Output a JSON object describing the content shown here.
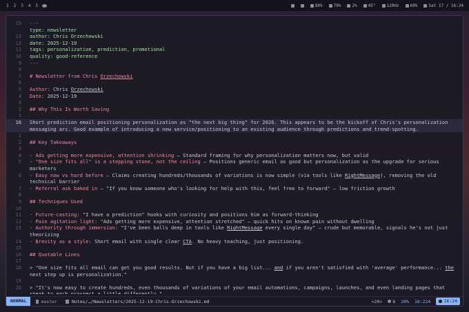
{
  "topbar": {
    "workspaces": [
      "1",
      "2",
      "3",
      "4",
      "5"
    ],
    "active_workspace": "3",
    "status": [
      {
        "icon": "keyboard-icon",
        "text": ""
      },
      {
        "icon": "refresh-icon",
        "text": ""
      },
      {
        "icon": "heart-icon",
        "text": "80%"
      },
      {
        "icon": "volume-icon",
        "text": "79%"
      },
      {
        "icon": "cpu-icon",
        "text": "2%"
      },
      {
        "icon": "temperature-icon",
        "text": "45°"
      },
      {
        "icon": "refresh-rate-icon",
        "text": "120Hz"
      },
      {
        "icon": "battery-icon",
        "text": "60%"
      },
      {
        "icon": "clock-icon",
        "text": "Sat 17 / 16:24"
      }
    ]
  },
  "editor": {
    "lines": [
      {
        "n": "15",
        "segs": [
          {
            "t": "---",
            "c": "fm"
          }
        ]
      },
      {
        "n": "",
        "segs": [
          {
            "t": "type: ",
            "c": "key"
          },
          {
            "t": "newsletter",
            "c": "val"
          }
        ]
      },
      {
        "n": "13",
        "segs": [
          {
            "t": "author: Chris Orzechowski",
            "c": "key"
          }
        ]
      },
      {
        "n": "12",
        "segs": [
          {
            "t": "date: 2025-12-19",
            "c": "key"
          }
        ]
      },
      {
        "n": "11",
        "segs": [
          {
            "t": "tags: personalization, prediction, promotional",
            "c": "key"
          }
        ]
      },
      {
        "n": "10",
        "segs": [
          {
            "t": "quality: good-reference",
            "c": "key"
          }
        ]
      },
      {
        "n": "9",
        "segs": [
          {
            "t": "---",
            "c": "fm"
          }
        ]
      },
      {
        "n": "8",
        "segs": []
      },
      {
        "n": "7",
        "segs": [
          {
            "t": "# Newsletter from Chris ",
            "c": "h"
          },
          {
            "t": "Orzechowski",
            "c": "h link"
          }
        ]
      },
      {
        "n": "6",
        "segs": []
      },
      {
        "n": "5",
        "segs": [
          {
            "t": "Author: ",
            "c": "h"
          },
          {
            "t": "Chris ",
            "c": ""
          },
          {
            "t": "Orzechowski",
            "c": "link"
          }
        ]
      },
      {
        "n": "4",
        "segs": [
          {
            "t": "Date: ",
            "c": "h"
          },
          {
            "t": "2025-12-19",
            "c": ""
          }
        ]
      },
      {
        "n": "3",
        "segs": []
      },
      {
        "n": "2",
        "segs": [
          {
            "t": "## Why This Is Worth Saving",
            "c": "h"
          }
        ]
      },
      {
        "n": "1",
        "segs": []
      },
      {
        "n": "16",
        "cur": true,
        "segs": [
          {
            "t": "Short prediction email positioning personalization as \"the next big thing\" for 2026. This appears to be the kickoff of Chris's personalization",
            "c": ""
          }
        ]
      },
      {
        "n": "",
        "cur": true,
        "segs": [
          {
            "t": "messaging arc. Good example of introducing a new service/positioning to an existing audience through predictions and trend-spotting.",
            "c": ""
          }
        ]
      },
      {
        "n": "1",
        "segs": []
      },
      {
        "n": "2",
        "segs": [
          {
            "t": "## Key Takeaways",
            "c": "h"
          }
        ]
      },
      {
        "n": "3",
        "segs": []
      },
      {
        "n": "4",
        "segs": [
          {
            "t": "- Ads getting more expensive, attention shrinking",
            "c": "bul"
          },
          {
            "t": " — Standard framing for why personalization matters now, but valid",
            "c": ""
          }
        ]
      },
      {
        "n": "5",
        "segs": [
          {
            "t": "- \"One size fits all\" is a stepping stone, not the ceiling",
            "c": "bul"
          },
          {
            "t": " — Positions generic email as good but personalization as the upgrade for serious",
            "c": ""
          }
        ]
      },
      {
        "n": "",
        "segs": [
          {
            "t": "marketers",
            "c": ""
          }
        ]
      },
      {
        "n": "6",
        "segs": [
          {
            "t": "- Easy now vs hard before",
            "c": "bul"
          },
          {
            "t": " — Claims creating hundreds/thousands of variations is now simple (via tools like ",
            "c": ""
          },
          {
            "t": "RightMessage",
            "c": "link"
          },
          {
            "t": "), removing the old",
            "c": ""
          }
        ]
      },
      {
        "n": "",
        "segs": [
          {
            "t": "technical barrier",
            "c": ""
          }
        ]
      },
      {
        "n": "7",
        "segs": [
          {
            "t": "- Referral ask baked in",
            "c": "bul"
          },
          {
            "t": " — \"If you know someone who's looking for help with this, feel free to forward\" — low friction growth",
            "c": ""
          }
        ]
      },
      {
        "n": "8",
        "segs": []
      },
      {
        "n": "9",
        "segs": [
          {
            "t": "## Techniques Used",
            "c": "h"
          }
        ]
      },
      {
        "n": "10",
        "segs": []
      },
      {
        "n": "11",
        "segs": [
          {
            "t": "- Future-casting:",
            "c": "bul"
          },
          {
            "t": " \"I have a prediction\" hooks with curiosity and positions him as forward-thinking",
            "c": ""
          }
        ]
      },
      {
        "n": "12",
        "segs": [
          {
            "t": "- Pain agitation light:",
            "c": "bul"
          },
          {
            "t": " \"Ads getting more expensive, attention stretched\" — quick hits on known pain without dwelling",
            "c": ""
          }
        ]
      },
      {
        "n": "13",
        "segs": [
          {
            "t": "- Authority through immersion:",
            "c": "bul"
          },
          {
            "t": " \"I've been balls deep in tools like ",
            "c": ""
          },
          {
            "t": "RightMessage",
            "c": "link"
          },
          {
            "t": " every single day\" — crude but memorable, signals he's not just",
            "c": ""
          }
        ]
      },
      {
        "n": "",
        "segs": [
          {
            "t": "theorizing",
            "c": ""
          }
        ]
      },
      {
        "n": "14",
        "segs": [
          {
            "t": "- Brevity as a style:",
            "c": "bul"
          },
          {
            "t": " Short email with single clear ",
            "c": ""
          },
          {
            "t": "CTA",
            "c": "link"
          },
          {
            "t": ". No heavy teaching, just positioning.",
            "c": ""
          }
        ]
      },
      {
        "n": "15",
        "segs": []
      },
      {
        "n": "16",
        "segs": [
          {
            "t": "## Quotable Lines",
            "c": "h"
          }
        ]
      },
      {
        "n": "17",
        "segs": []
      },
      {
        "n": "18",
        "segs": [
          {
            "t": "> \"One size fits all email can get you good results. But if you have a big list... ",
            "c": ""
          },
          {
            "t": "and",
            "c": "link"
          },
          {
            "t": " if you aren't satisfied with 'average' performance... ",
            "c": ""
          },
          {
            "t": "the",
            "c": "link"
          }
        ]
      },
      {
        "n": "",
        "segs": [
          {
            "t": "next step up is personalization.\"",
            "c": ""
          }
        ]
      },
      {
        "n": "19",
        "segs": []
      },
      {
        "n": "20",
        "segs": [
          {
            "t": "> \"It's now easy to create hundreds, even thousands of variations of your email automations, campaigns, launches, and even landing pages that",
            "c": ""
          }
        ]
      },
      {
        "n": "",
        "segs": [
          {
            "t": "speak to each prospect a little differently.\"",
            "c": ""
          }
        ]
      }
    ]
  },
  "statusline": {
    "mode": "NORMAL",
    "branch": "master",
    "file": "Notes/…/Newsletters/2025-12-19-Chris-Orzechowski.md",
    "lsp": "<20>",
    "count": "8",
    "percent": "20%",
    "position": "16:224",
    "time": "16:24"
  }
}
